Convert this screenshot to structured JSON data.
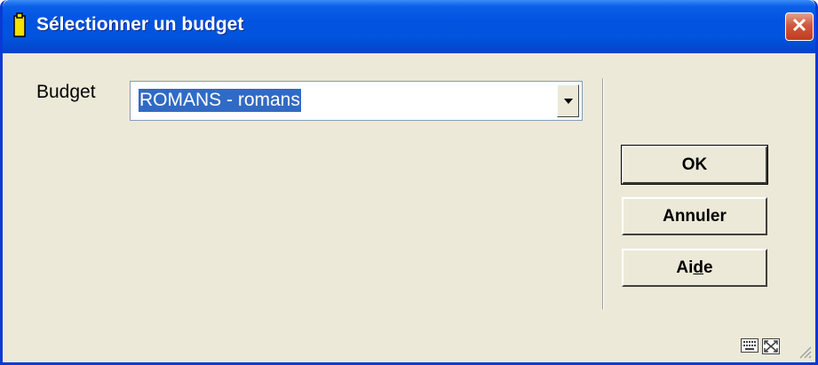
{
  "window": {
    "title": "Sélectionner un budget",
    "close_label": "×"
  },
  "form": {
    "budget_label": "Budget",
    "budget_value": "ROMANS - romans"
  },
  "buttons": {
    "ok": "OK",
    "annuler": "Annuler",
    "aide_prefix": "Ai",
    "aide_underlined": "d",
    "aide_suffix": "e"
  },
  "icons": {
    "title": "clipboard-icon",
    "close": "close-icon",
    "dropdown": "chevron-down-icon",
    "keyboard": "keyboard-icon",
    "expand": "expand-icon",
    "grip": "resize-grip-icon"
  },
  "colors": {
    "titlebar": "#0154de",
    "selection": "#316ac5",
    "face": "#ece9d8",
    "close": "#c13c1e"
  }
}
